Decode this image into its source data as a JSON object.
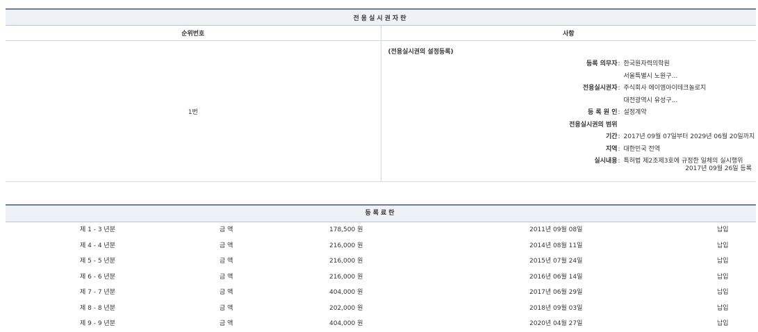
{
  "rights_section": {
    "title": "전용실시권자란",
    "col_rank": "순위번호",
    "col_detail": "사항",
    "entry": {
      "rank": "1번",
      "heading": "(전용실시권의 설정등록)",
      "rows": [
        {
          "label": "등록 의무자",
          "colon": ":",
          "value": "한국원자력의학원"
        },
        {
          "label": "",
          "colon": "",
          "value": "서울특별시 노원구..."
        },
        {
          "label": "전용실시권자",
          "colon": ":",
          "value": "주식회사 에이엠아이테크놀로지"
        },
        {
          "label": "",
          "colon": "",
          "value": "대전광역시 유성구..."
        },
        {
          "label": "등 록 원 인",
          "colon": ":",
          "value": "설정계약"
        },
        {
          "label": "전용실시권의 범위",
          "colon": "",
          "value": ""
        },
        {
          "label": "기간",
          "colon": ":",
          "value": "2017년 09월 07일부터 2029년 06월 20일까지"
        },
        {
          "label": "지역",
          "colon": ":",
          "value": "대한민국 전역"
        },
        {
          "label": "실시내용",
          "colon": ":",
          "value": "특허법 제2조제3호에 규정한 일체의 실시행위"
        }
      ],
      "registered_date": "2017년 09월 26일 등록"
    }
  },
  "fee_section": {
    "title": "등록료란",
    "rows": [
      {
        "period": "제 1 - 3 년분",
        "label": "금 액",
        "amount": "178,500 원",
        "date": "2011년 09월 08일",
        "status": "납입"
      },
      {
        "period": "제 4 - 4 년분",
        "label": "금 액",
        "amount": "216,000 원",
        "date": "2014년 08월 11일",
        "status": "납입"
      },
      {
        "period": "제 5 - 5 년분",
        "label": "금 액",
        "amount": "216,000 원",
        "date": "2015년 07월 24일",
        "status": "납입"
      },
      {
        "period": "제 6 - 6 년분",
        "label": "금 액",
        "amount": "216,000 원",
        "date": "2016년 06월 14일",
        "status": "납입"
      },
      {
        "period": "제 7 - 7 년분",
        "label": "금 액",
        "amount": "404,000 원",
        "date": "2017년 06월 29일",
        "status": "납입"
      },
      {
        "period": "제 8 - 8 년분",
        "label": "금 액",
        "amount": "202,000 원",
        "date": "2018년 09월 03일",
        "status": "납입"
      },
      {
        "period": "제 9 - 9 년분",
        "label": "금 액",
        "amount": "404,000 원",
        "date": "2020년 04월 27일",
        "status": "납입"
      }
    ]
  }
}
